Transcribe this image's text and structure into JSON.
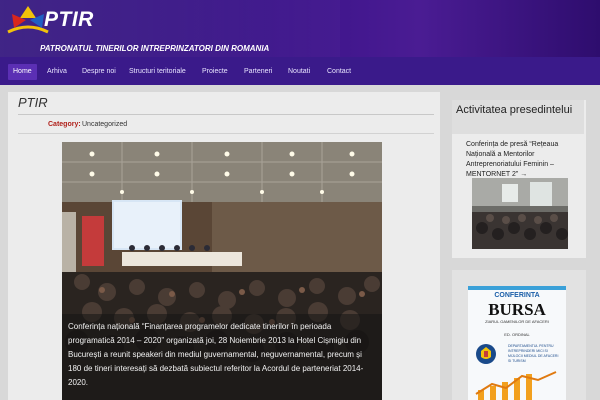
{
  "site": {
    "logo_title": "PTIR",
    "logo_subtitle": "PATRONATUL TINERILOR INTREPRINZATORI DIN ROMANIA"
  },
  "nav": {
    "items": [
      {
        "label": "Home",
        "active": true
      },
      {
        "label": "Arhiva"
      },
      {
        "label": "Despre noi"
      },
      {
        "label": "Structuri teritoriale"
      },
      {
        "label": "Proiecte"
      },
      {
        "label": "Parteneri"
      },
      {
        "label": "Noutati"
      },
      {
        "label": "Contact"
      }
    ]
  },
  "post": {
    "title": "PTIR",
    "category_label": "Category:",
    "category_value": "Uncategorized",
    "caption": "Conferința națională “Finanțarea programelor dedicate tinerilor în perioada programatică 2014 – 2020” organizată joi, 28 Noiembrie 2013 la Hotel Cișmigiu din București a reunit speakeri din mediul guvernamental, neguvernamental, precum și 180 de tineri interesați să dezbată subiectul referitor la Acordul de parteneriat 2014-2020."
  },
  "sidebar": {
    "widget1_title": "Activitatea presedintelui",
    "widget1_link": "Conferința de presă “Rețeaua Națională a Mentorilor Antreprenoriatului Feminin – MENTORNET 2” →",
    "widget2": {
      "conf": "CONFERINTA",
      "bursa": "BURSA",
      "bursa_sub": "ZIARUL OAMENILOR DE AFACERI",
      "date": "ED. ORDINAL",
      "dept": "DEPARTAMENTUL PENTRU INTREPRINDERI MICI SI MIJLOCII MEDIUL DE AFACERI SI TURISM"
    }
  },
  "colors": {
    "header": "#2a0c78",
    "nav": "#3a1a8a",
    "nav_active": "#5b2fb4",
    "category": "#b0201a"
  }
}
